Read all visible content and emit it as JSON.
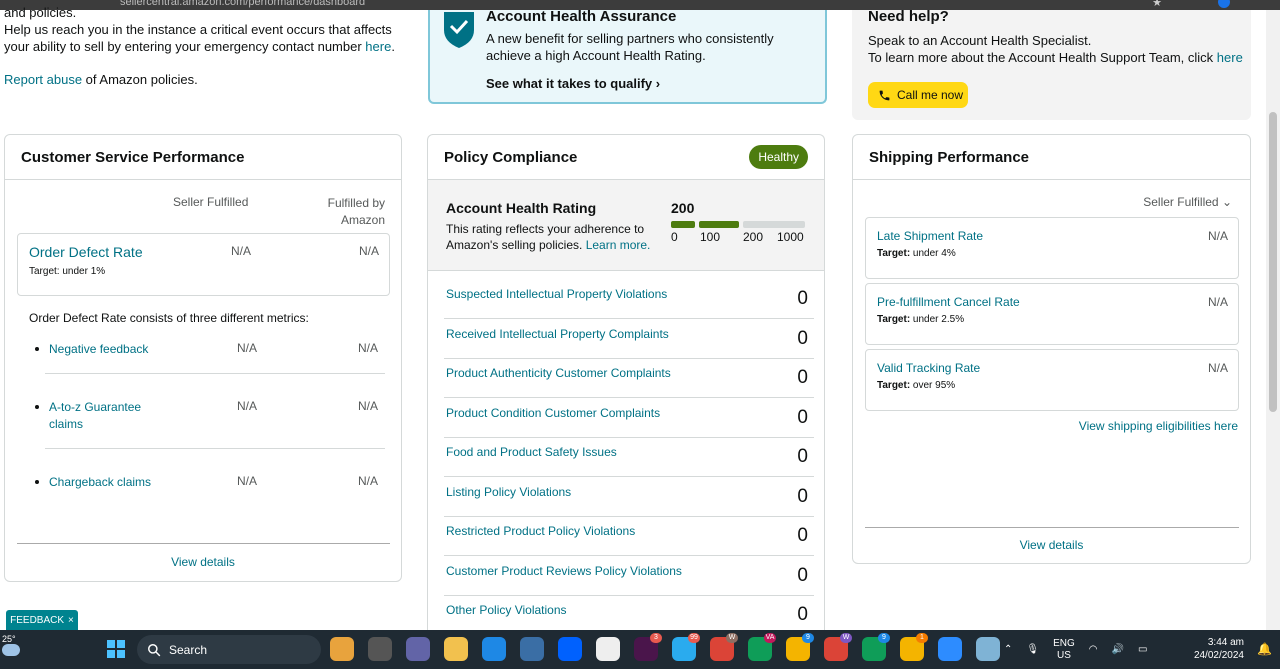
{
  "browser": {
    "url": "sellercentral.amazon.com/performance/dashboard"
  },
  "top_left": {
    "cut_line": "and policies.",
    "emergency_text": "Help us reach you in the instance a critical event occurs that affects your ability to sell by entering your emergency contact number ",
    "emergency_link": "here",
    "emergency_end": ".",
    "report_link": "Report abuse",
    "report_text": " of Amazon policies."
  },
  "assurance": {
    "title": "Account Health Assurance",
    "description": "A new benefit for selling partners who consistently achieve a high Account Health Rating.",
    "qualify_link": "See what it takes to qualify",
    "colors": {
      "border": "#7fc7d9",
      "background": "#eaf7fa",
      "shield": "#007185"
    }
  },
  "help": {
    "title": "Need help?",
    "line1": "Speak to an Account Health Specialist.",
    "line2_text": "To learn more about the Account Health Support Team, click ",
    "line2_link": "here",
    "call_button": "Call me now"
  },
  "customer_service": {
    "title": "Customer Service Performance",
    "col1": "Seller Fulfilled",
    "col2": "Fulfilled by Amazon",
    "odr": {
      "name": "Order Defect Rate",
      "target": "Target: under 1%",
      "v1": "N/A",
      "v2": "N/A"
    },
    "intro": "Order Defect Rate consists of three different metrics:",
    "metrics": [
      {
        "name": "Negative feedback",
        "v1": "N/A",
        "v2": "N/A"
      },
      {
        "name": "A-to-z Guarantee claims",
        "v1": "N/A",
        "v2": "N/A"
      },
      {
        "name": "Chargeback claims",
        "v1": "N/A",
        "v2": "N/A"
      }
    ],
    "details": "View details"
  },
  "policy": {
    "title": "Policy Compliance",
    "badge": "Healthy",
    "rating_title": "Account Health Rating",
    "rating_desc": "This rating reflects your adherence to Amazon's selling policies. ",
    "learn_more": "Learn more.",
    "score": "200",
    "score_fraction_of_scale": 0.5,
    "ticks": [
      "0",
      "100",
      "200",
      "1000"
    ],
    "violations": [
      {
        "name": "Suspected Intellectual Property Violations",
        "count": "0"
      },
      {
        "name": "Received Intellectual Property Complaints",
        "count": "0"
      },
      {
        "name": "Product Authenticity Customer Complaints",
        "count": "0"
      },
      {
        "name": "Product Condition Customer Complaints",
        "count": "0"
      },
      {
        "name": "Food and Product Safety Issues",
        "count": "0"
      },
      {
        "name": "Listing Policy Violations",
        "count": "0"
      },
      {
        "name": "Restricted Product Policy Violations",
        "count": "0"
      },
      {
        "name": "Customer Product Reviews Policy Violations",
        "count": "0"
      },
      {
        "name": "Other Policy Violations",
        "count": "0"
      }
    ],
    "colors": {
      "badge": "#4d7c0f",
      "bar_fill": "#4d7c0f",
      "bar_empty": "#d5d9d9"
    }
  },
  "shipping": {
    "title": "Shipping Performance",
    "dropdown": "Seller Fulfilled",
    "metrics": [
      {
        "name": "Late Shipment Rate",
        "target_label": "Target:",
        "target": " under 4%",
        "value": "N/A"
      },
      {
        "name": "Pre-fulfillment Cancel Rate",
        "target_label": "Target:",
        "target": " under 2.5%",
        "value": "N/A"
      },
      {
        "name": "Valid Tracking Rate",
        "target_label": "Target:",
        "target": " over 95%",
        "value": "N/A"
      }
    ],
    "eligibilities_link": "View shipping eligibilities here",
    "details": "View details"
  },
  "feedback": {
    "label": "FEEDBACK",
    "close": "×"
  },
  "taskbar": {
    "temp": "25°",
    "search": "Search",
    "lang_top": "ENG",
    "lang_bottom": "US",
    "time": "3:44 am",
    "date": "24/02/2024",
    "badges": [
      "3",
      "99",
      "W",
      "VA",
      "9",
      "W",
      "9",
      "1"
    ]
  }
}
